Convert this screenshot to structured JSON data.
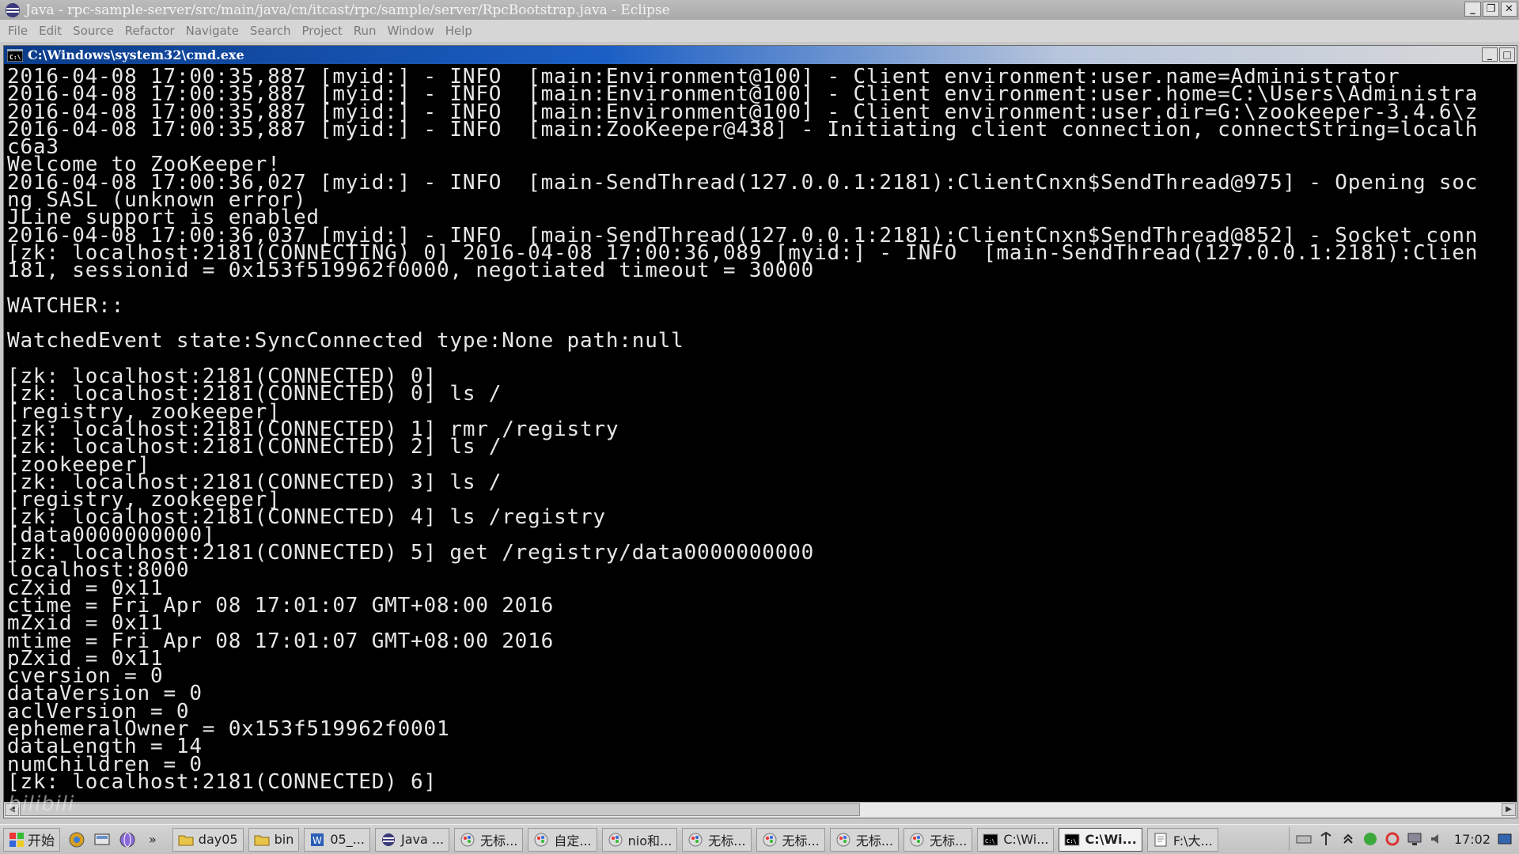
{
  "eclipse": {
    "title": "Java - rpc-sample-server/src/main/java/cn/itcast/rpc/sample/server/RpcBootstrap.java - Eclipse",
    "menu": [
      "File",
      "Edit",
      "Source",
      "Refactor",
      "Navigate",
      "Search",
      "Project",
      "Run",
      "Window",
      "Help"
    ]
  },
  "cmd": {
    "title": "C:\\Windows\\system32\\cmd.exe",
    "lines": [
      "2016-04-08 17:00:35,887 [myid:] - INFO  [main:Environment@100] - Client environment:user.name=Administrator",
      "2016-04-08 17:00:35,887 [myid:] - INFO  [main:Environment@100] - Client environment:user.home=C:\\Users\\Administra",
      "2016-04-08 17:00:35,887 [myid:] - INFO  [main:Environment@100] - Client environment:user.dir=G:\\zookeeper-3.4.6\\z",
      "2016-04-08 17:00:35,887 [myid:] - INFO  [main:ZooKeeper@438] - Initiating client connection, connectString=localh",
      "c6a3",
      "Welcome to ZooKeeper!",
      "2016-04-08 17:00:36,027 [myid:] - INFO  [main-SendThread(127.0.0.1:2181):ClientCnxn$SendThread@975] - Opening soc",
      "ng SASL (unknown error)",
      "JLine support is enabled",
      "2016-04-08 17:00:36,037 [myid:] - INFO  [main-SendThread(127.0.0.1:2181):ClientCnxn$SendThread@852] - Socket conn",
      "[zk: localhost:2181(CONNECTING) 0] 2016-04-08 17:00:36,089 [myid:] - INFO  [main-SendThread(127.0.0.1:2181):Clien",
      "181, sessionid = 0x153f519962f0000, negotiated timeout = 30000",
      "",
      "WATCHER::",
      "",
      "WatchedEvent state:SyncConnected type:None path:null",
      "",
      "[zk: localhost:2181(CONNECTED) 0]",
      "[zk: localhost:2181(CONNECTED) 0] ls /",
      "[registry, zookeeper]",
      "[zk: localhost:2181(CONNECTED) 1] rmr /registry",
      "[zk: localhost:2181(CONNECTED) 2] ls /",
      "[zookeeper]",
      "[zk: localhost:2181(CONNECTED) 3] ls /",
      "[registry, zookeeper]",
      "[zk: localhost:2181(CONNECTED) 4] ls /registry",
      "[data0000000000]",
      "[zk: localhost:2181(CONNECTED) 5] get /registry/data0000000000",
      "localhost:8000",
      "cZxid = 0x11",
      "ctime = Fri Apr 08 17:01:07 GMT+08:00 2016",
      "mZxid = 0x11",
      "mtime = Fri Apr 08 17:01:07 GMT+08:00 2016",
      "pZxid = 0x11",
      "cversion = 0",
      "dataVersion = 0",
      "aclVersion = 0",
      "ephemeralOwner = 0x153f519962f0001",
      "dataLength = 14",
      "numChildren = 0",
      "[zk: localhost:2181(CONNECTED) 6]"
    ]
  },
  "watermark": "bilibili",
  "taskbar": {
    "start_label": "开始",
    "tasks": [
      {
        "label": "day05",
        "icon": "folder-icon"
      },
      {
        "label": "bin",
        "icon": "folder-icon"
      },
      {
        "label": "05_...",
        "icon": "word-icon"
      },
      {
        "label": "Java ...",
        "icon": "eclipse-icon"
      },
      {
        "label": "无标...",
        "icon": "paint-icon"
      },
      {
        "label": "自定...",
        "icon": "paint-icon"
      },
      {
        "label": "nio和...",
        "icon": "paint-icon"
      },
      {
        "label": "无标...",
        "icon": "paint-icon"
      },
      {
        "label": "无标...",
        "icon": "paint-icon"
      },
      {
        "label": "无标...",
        "icon": "paint-icon"
      },
      {
        "label": "无标...",
        "icon": "paint-icon"
      },
      {
        "label": "C:\\Wi...",
        "icon": "cmd-icon"
      },
      {
        "label": "C:\\Wi...",
        "icon": "cmd-icon",
        "active": true
      },
      {
        "label": "F:\\大...",
        "icon": "notepad-icon"
      }
    ],
    "clock": "17:02"
  }
}
